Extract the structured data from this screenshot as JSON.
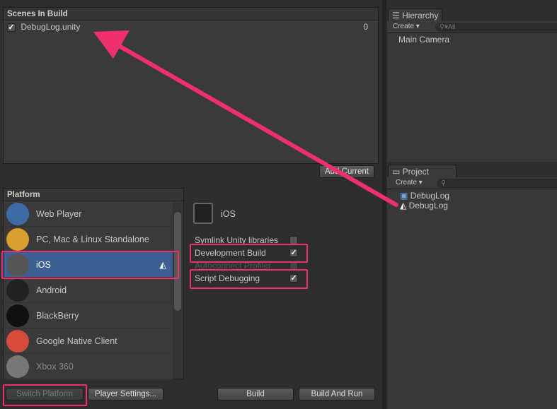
{
  "scenes": {
    "header": "Scenes In Build",
    "items": [
      {
        "name": "DebugLog.unity",
        "index": "0",
        "checked": true
      }
    ],
    "add_current": "Add Current"
  },
  "platform": {
    "header": "Platform",
    "items": [
      {
        "label": "Web Player",
        "icon": "globe-icon",
        "color": "#3f6aa8"
      },
      {
        "label": "PC, Mac & Linux Standalone",
        "icon": "standalone-icon",
        "color": "#d9a030"
      },
      {
        "label": "iOS",
        "icon": "ios-device-icon",
        "color": "#555"
      },
      {
        "label": "Android",
        "icon": "android-phone-icon",
        "color": "#222"
      },
      {
        "label": "BlackBerry",
        "icon": "blackberry-icon",
        "color": "#111"
      },
      {
        "label": "Google Native Client",
        "icon": "chrome-icon",
        "color": "#d64a3a"
      },
      {
        "label": "Xbox 360",
        "icon": "xbox-icon",
        "color": "#777"
      }
    ],
    "selected_index": 2
  },
  "settings": {
    "platform_name": "iOS",
    "symlink": "Symlink Unity libraries",
    "symlink_checked": false,
    "dev_build": "Development Build",
    "dev_build_checked": true,
    "autoconnect": "Autoconnect Profiler",
    "autoconnect_checked": false,
    "script_debug": "Script Debugging",
    "script_debug_checked": true
  },
  "buttons": {
    "switch_platform": "Switch Platform",
    "player_settings": "Player Settings...",
    "build": "Build",
    "build_and_run": "Build And Run"
  },
  "hierarchy": {
    "tab": "Hierarchy",
    "create": "Create",
    "search_placeholder": "All",
    "items": [
      "Main Camera"
    ]
  },
  "project": {
    "tab": "Project",
    "create": "Create",
    "items": [
      "DebugLog",
      "DebugLog"
    ]
  },
  "annotation_color": "#f0306e"
}
